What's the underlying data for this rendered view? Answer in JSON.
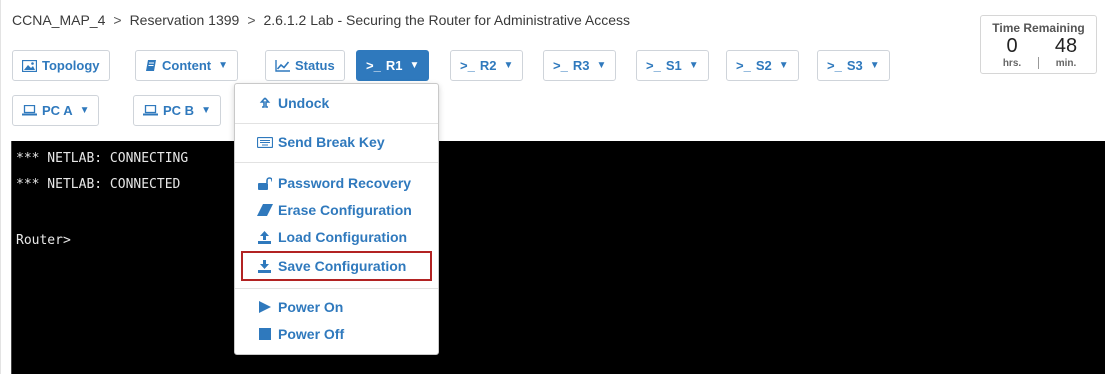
{
  "breadcrumb": {
    "items": [
      "CCNA_MAP_4",
      "Reservation 1399",
      "2.6.1.2 Lab - Securing the Router for Administrative Access"
    ],
    "separator": ">"
  },
  "timer": {
    "title": "Time Remaining",
    "hours": "0",
    "hours_label": "hrs.",
    "minutes": "48",
    "minutes_label": "min."
  },
  "tabs": [
    {
      "label": "Topology",
      "icon": "image-icon",
      "caret": false
    },
    {
      "label": "Content",
      "icon": "book-icon",
      "caret": true
    },
    {
      "label": "Status",
      "icon": "chart-icon",
      "caret": false
    },
    {
      "label": "R1",
      "icon": "terminal-icon",
      "caret": true,
      "active": true
    },
    {
      "label": "R2",
      "icon": "terminal-icon",
      "caret": true
    },
    {
      "label": "R3",
      "icon": "terminal-icon",
      "caret": true
    },
    {
      "label": "S1",
      "icon": "terminal-icon",
      "caret": true
    },
    {
      "label": "S2",
      "icon": "terminal-icon",
      "caret": true
    },
    {
      "label": "S3",
      "icon": "terminal-icon",
      "caret": true
    },
    {
      "label": "PC A",
      "icon": "laptop-icon",
      "caret": true
    },
    {
      "label": "PC B",
      "icon": "laptop-icon",
      "caret": true
    }
  ],
  "terminal": {
    "lines": [
      "*** NETLAB: CONNECTING",
      "*** NETLAB: CONNECTED",
      "",
      "Router>"
    ]
  },
  "menu": {
    "items": [
      {
        "label": "Undock",
        "icon": "undock-icon"
      },
      {
        "label": "Send Break Key",
        "icon": "keyboard-icon"
      },
      {
        "label": "Password Recovery",
        "icon": "unlock-icon"
      },
      {
        "label": "Erase Configuration",
        "icon": "eraser-icon"
      },
      {
        "label": "Load Configuration",
        "icon": "upload-icon"
      },
      {
        "label": "Save Configuration",
        "icon": "download-icon",
        "highlighted": true
      },
      {
        "label": "Power On",
        "icon": "play-icon"
      },
      {
        "label": "Power Off",
        "icon": "stop-icon"
      }
    ],
    "highlight_color": "#b22323"
  },
  "colors": {
    "accent": "#2f79bd",
    "terminal_bg": "#000000",
    "terminal_text": "#e8e8e8"
  }
}
